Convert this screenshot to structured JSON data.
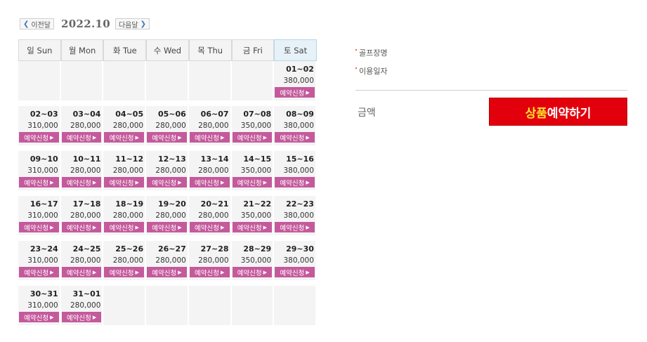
{
  "nav": {
    "prev_label": "이전달",
    "month": "2022.10",
    "next_label": "다음달"
  },
  "weekdays": [
    "일 Sun",
    "월 Mon",
    "화 Tue",
    "수 Wed",
    "목 Thu",
    "금 Fri",
    "토 Sat"
  ],
  "weeks": [
    [
      null,
      null,
      null,
      null,
      null,
      null,
      {
        "date": "01~02",
        "price": "380,000",
        "btn": "예약신청"
      }
    ],
    [
      {
        "date": "02~03",
        "price": "310,000",
        "btn": "예약신청"
      },
      {
        "date": "03~04",
        "price": "280,000",
        "btn": "예약신청"
      },
      {
        "date": "04~05",
        "price": "280,000",
        "btn": "예약신청"
      },
      {
        "date": "05~06",
        "price": "280,000",
        "btn": "예약신청"
      },
      {
        "date": "06~07",
        "price": "280,000",
        "btn": "예약신청"
      },
      {
        "date": "07~08",
        "price": "350,000",
        "btn": "예약신청"
      },
      {
        "date": "08~09",
        "price": "380,000",
        "btn": "예약신청"
      }
    ],
    [
      {
        "date": "09~10",
        "price": "310,000",
        "btn": "예약신청"
      },
      {
        "date": "10~11",
        "price": "280,000",
        "btn": "예약신청"
      },
      {
        "date": "11~12",
        "price": "280,000",
        "btn": "예약신청"
      },
      {
        "date": "12~13",
        "price": "280,000",
        "btn": "예약신청"
      },
      {
        "date": "13~14",
        "price": "280,000",
        "btn": "예약신청"
      },
      {
        "date": "14~15",
        "price": "350,000",
        "btn": "예약신청"
      },
      {
        "date": "15~16",
        "price": "380,000",
        "btn": "예약신청"
      }
    ],
    [
      {
        "date": "16~17",
        "price": "310,000",
        "btn": "예약신청"
      },
      {
        "date": "17~18",
        "price": "280,000",
        "btn": "예약신청"
      },
      {
        "date": "18~19",
        "price": "280,000",
        "btn": "예약신청"
      },
      {
        "date": "19~20",
        "price": "280,000",
        "btn": "예약신청"
      },
      {
        "date": "20~21",
        "price": "280,000",
        "btn": "예약신청"
      },
      {
        "date": "21~22",
        "price": "350,000",
        "btn": "예약신청"
      },
      {
        "date": "22~23",
        "price": "380,000",
        "btn": "예약신청"
      }
    ],
    [
      {
        "date": "23~24",
        "price": "310,000",
        "btn": "예약신청"
      },
      {
        "date": "24~25",
        "price": "280,000",
        "btn": "예약신청"
      },
      {
        "date": "25~26",
        "price": "280,000",
        "btn": "예약신청"
      },
      {
        "date": "26~27",
        "price": "280,000",
        "btn": "예약신청"
      },
      {
        "date": "27~28",
        "price": "280,000",
        "btn": "예약신청"
      },
      {
        "date": "28~29",
        "price": "350,000",
        "btn": "예약신청"
      },
      {
        "date": "29~30",
        "price": "380,000",
        "btn": "예약신청"
      }
    ],
    [
      {
        "date": "30~31",
        "price": "310,000",
        "btn": "예약신청"
      },
      {
        "date": "31~01",
        "price": "280,000",
        "btn": "예약신청"
      },
      null,
      null,
      null,
      null,
      null
    ]
  ],
  "info": {
    "course_label": "골프장명",
    "date_label": "이용일자"
  },
  "amount_label": "금액",
  "book": {
    "highlight": "상품",
    "rest": "예약하기"
  },
  "colors": {
    "book_button": "#e3000d",
    "book_highlight": "#ffe22d",
    "reserve_button": "#c45a9c",
    "sat_header": "#e6f2f8"
  }
}
